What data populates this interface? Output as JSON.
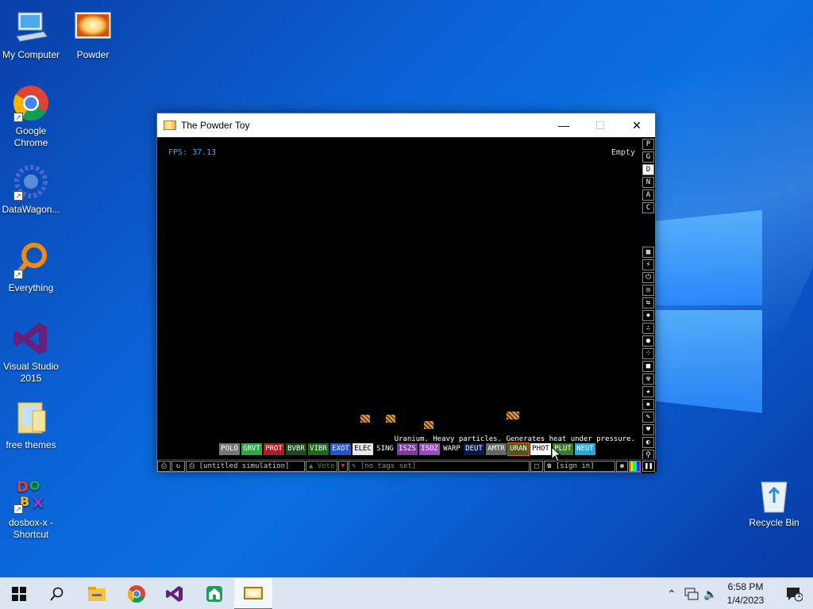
{
  "desktop": {
    "icons": [
      {
        "label": "My Computer",
        "icon": "computer-icon"
      },
      {
        "label": "Powder",
        "icon": "powder-icon"
      },
      {
        "label": "Google Chrome",
        "icon": "chrome-icon"
      },
      {
        "label": "DataWagon...",
        "icon": "datawagon-icon"
      },
      {
        "label": "Everything",
        "icon": "everything-icon"
      },
      {
        "label": "Visual Studio 2015",
        "icon": "visual-studio-icon"
      },
      {
        "label": "free themes",
        "icon": "folder-icon"
      },
      {
        "label": "dosbox-x - Shortcut",
        "icon": "dosbox-icon"
      },
      {
        "label": "Recycle Bin",
        "icon": "recycle-bin-icon"
      }
    ]
  },
  "window": {
    "title": "The Powder Toy",
    "fps": "FPS: 37.13",
    "hover_status": "Empty",
    "element_desc": "Uranium. Heavy particles. Generates heat under pressure.",
    "right_menu_top": [
      "P",
      "G",
      "D",
      "N",
      "A",
      "C"
    ],
    "active_top": "D",
    "right_menu_icons": [
      "walls-icon",
      "electronics-icon",
      "powered-icon",
      "sensors-icon",
      "force-icon",
      "explosives-icon",
      "gases-icon",
      "liquids-icon",
      "powders-icon",
      "solids-icon",
      "radioactive-icon",
      "special-icon",
      "game-of-life-icon",
      "tools-icon",
      "favorites-icon",
      "decoration-icon",
      "search-icon"
    ],
    "elements": [
      {
        "label": "POLO",
        "bg": "#777777",
        "fg": "#ffffff"
      },
      {
        "label": "GRVT",
        "bg": "#2ea844",
        "fg": "#ffffff"
      },
      {
        "label": "PROT",
        "bg": "#aa1e22",
        "fg": "#ffffff"
      },
      {
        "label": "BVBR",
        "bg": "#1c4a1c",
        "fg": "#ffffff"
      },
      {
        "label": "VIBR",
        "bg": "#1a6a1a",
        "fg": "#ffffff"
      },
      {
        "label": "EXOT",
        "bg": "#2356c8",
        "fg": "#ffffff"
      },
      {
        "label": "ELEC",
        "bg": "#e8e8e8",
        "fg": "#000000"
      },
      {
        "label": "SING",
        "bg": "#000000",
        "fg": "#ffffff"
      },
      {
        "label": "ISZS",
        "bg": "#7a3aa0",
        "fg": "#ffffff"
      },
      {
        "label": "ISOZ",
        "bg": "#9a4ac0",
        "fg": "#ffffff"
      },
      {
        "label": "WARP",
        "bg": "#000000",
        "fg": "#ffffff"
      },
      {
        "label": "DEUT",
        "bg": "#0a1a50",
        "fg": "#ffffff"
      },
      {
        "label": "AMTR",
        "bg": "#666666",
        "fg": "#ffffff"
      },
      {
        "label": "URAN",
        "bg": "#4a5a1a",
        "fg": "#ffffff"
      },
      {
        "label": "PHOT",
        "bg": "#ffffff",
        "fg": "#000000"
      },
      {
        "label": "PLUT",
        "bg": "#3a7a2a",
        "fg": "#ffffff"
      },
      {
        "label": "NEUT",
        "bg": "#28a8d8",
        "fg": "#ffffff"
      }
    ],
    "bottom": {
      "save_name": "[untitled simulation]",
      "vote_label": "Vote",
      "tags": "[no tags set]",
      "signin": "[sign in]"
    }
  },
  "taskbar": {
    "apps": [
      "start-icon",
      "search-icon",
      "file-explorer-icon",
      "chrome-icon",
      "visual-studio-icon",
      "app-icon",
      "powder-toy-icon"
    ],
    "active_app": "powder-toy-icon",
    "time": "6:58 PM",
    "date": "1/4/2023",
    "notification_count": "1"
  }
}
